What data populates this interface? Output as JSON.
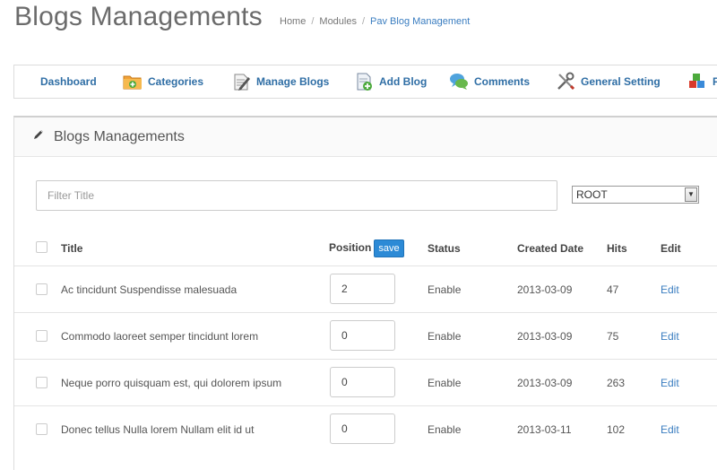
{
  "header": {
    "title": "Blogs Managements",
    "breadcrumb": [
      "Home",
      "Modules",
      "Pav Blog Management"
    ]
  },
  "toolbar": {
    "items": [
      {
        "label": "Dashboard",
        "icon": "dashboard"
      },
      {
        "label": "Categories",
        "icon": "folder-add-icon"
      },
      {
        "label": "Manage Blogs",
        "icon": "edit-document-icon"
      },
      {
        "label": "Add Blog",
        "icon": "add-document-icon"
      },
      {
        "label": "Comments",
        "icon": "comments-icon"
      },
      {
        "label": "General Setting",
        "icon": "tools-icon"
      },
      {
        "label": "F",
        "icon": "blocks-icon"
      }
    ]
  },
  "panel": {
    "title": "Blogs Managements",
    "title_icon": "pencil-icon"
  },
  "filters": {
    "title_placeholder": "Filter Title",
    "category_selected": "ROOT"
  },
  "table": {
    "headers": {
      "title": "Title",
      "position": "Position",
      "save": "save",
      "status": "Status",
      "created": "Created Date",
      "hits": "Hits",
      "edit": "Edit"
    },
    "rows": [
      {
        "title": "Ac tincidunt Suspendisse malesuada",
        "position": "2",
        "status": "Enable",
        "created": "2013-03-09",
        "hits": "47",
        "edit": "Edit"
      },
      {
        "title": "Commodo laoreet semper tincidunt lorem",
        "position": "0",
        "status": "Enable",
        "created": "2013-03-09",
        "hits": "75",
        "edit": "Edit"
      },
      {
        "title": "Neque porro quisquam est, qui dolorem ipsum",
        "position": "0",
        "status": "Enable",
        "created": "2013-03-09",
        "hits": "263",
        "edit": "Edit"
      },
      {
        "title": "Donec tellus Nulla lorem Nullam elit id ut",
        "position": "0",
        "status": "Enable",
        "created": "2013-03-11",
        "hits": "102",
        "edit": "Edit"
      }
    ]
  },
  "colors": {
    "link": "#2f6ea5",
    "accent_button": "#2c8ad6"
  }
}
